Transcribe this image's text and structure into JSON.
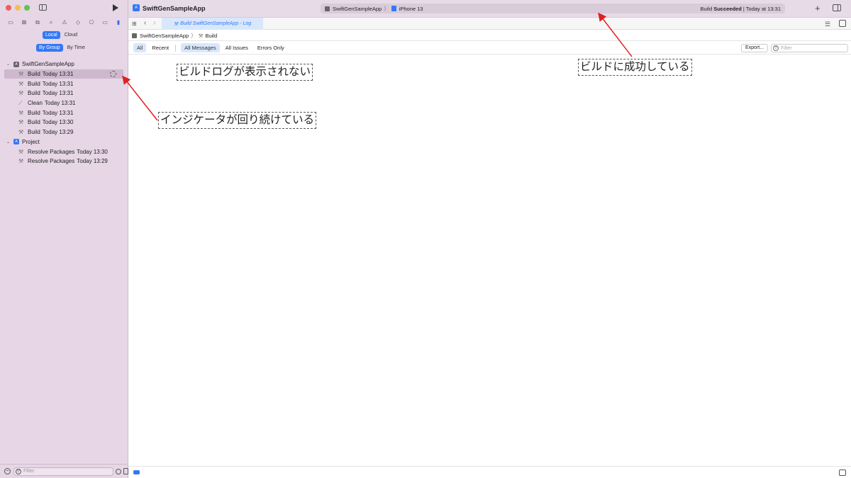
{
  "window": {
    "app_title": "SwiftGenSampleApp",
    "scheme": "SwiftGenSampleApp",
    "destination": "iPhone 13",
    "status_prefix": "Build ",
    "status_bold": "Succeeded",
    "status_suffix": " | Today at 13:31"
  },
  "sidebar": {
    "nav_icons": [
      "folder-icon",
      "source-control-icon",
      "symbol-icon",
      "find-icon",
      "issue-icon",
      "test-icon",
      "debug-icon",
      "breakpoint-icon",
      "report-icon"
    ],
    "location_tabs": [
      "Local",
      "Cloud"
    ],
    "grouping_tabs": [
      "By Group",
      "By Time"
    ],
    "groups": [
      {
        "name": "SwiftGenSampleApp",
        "items": [
          {
            "action": "Build",
            "time": "Today 13:31"
          },
          {
            "action": "Build",
            "time": "Today 13:31"
          },
          {
            "action": "Build",
            "time": "Today 13:31"
          },
          {
            "action": "Clean",
            "time": "Today 13:31"
          },
          {
            "action": "Build",
            "time": "Today 13:31"
          },
          {
            "action": "Build",
            "time": "Today 13:30"
          },
          {
            "action": "Build",
            "time": "Today 13:29"
          }
        ]
      },
      {
        "name": "Project",
        "items": [
          {
            "action": "Resolve Packages",
            "time": "Today 13:30"
          },
          {
            "action": "Resolve Packages",
            "time": "Today 13:29"
          }
        ]
      }
    ],
    "filter_placeholder": "Filter"
  },
  "editor": {
    "tab_label": "Build SwiftGenSampleApp - Log",
    "breadcrumb": [
      "SwiftGenSampleApp",
      "Build"
    ],
    "scope_filters": [
      "All",
      "Recent"
    ],
    "message_filters": [
      "All Messages",
      "All Issues",
      "Errors Only"
    ],
    "export_label": "Export...",
    "search_placeholder": "Filter"
  },
  "annotations": {
    "no_log": "ビルドログが表示されない",
    "build_success": "ビルドに成功している",
    "spinner": "インジケータが回り続けている"
  },
  "colors": {
    "accent": "#3478f6",
    "sidebar_bg": "#e6d6e6",
    "arrow": "#e02020"
  }
}
